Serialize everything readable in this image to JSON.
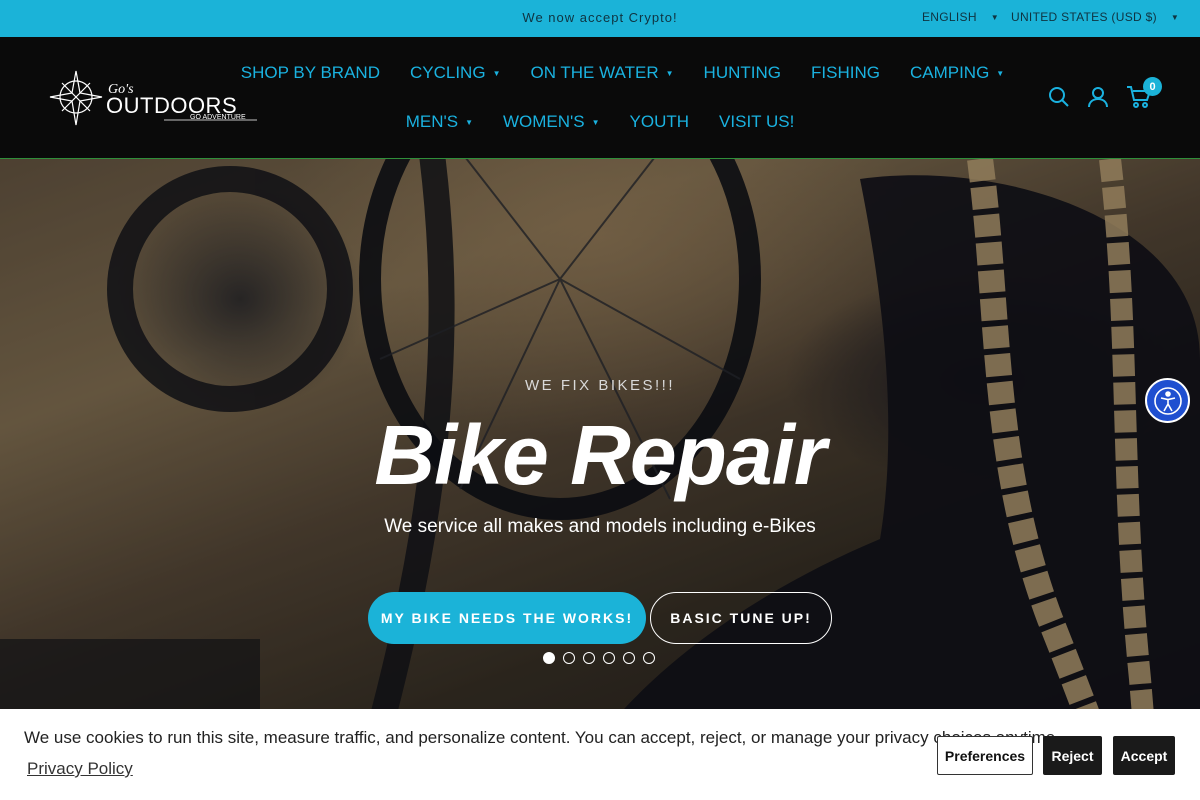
{
  "announcement": {
    "message": "We now accept Crypto!",
    "language": "ENGLISH",
    "currency": "UNITED STATES (USD $)"
  },
  "header": {
    "logo_alt": "Go's OUTDOORS GO ADVENTURE",
    "nav_row1": [
      {
        "label": "SHOP BY BRAND",
        "dropdown": false
      },
      {
        "label": "CYCLING",
        "dropdown": true
      },
      {
        "label": "ON THE WATER",
        "dropdown": true
      },
      {
        "label": "HUNTING",
        "dropdown": false
      },
      {
        "label": "FISHING",
        "dropdown": false
      },
      {
        "label": "CAMPING",
        "dropdown": true
      }
    ],
    "nav_row2": [
      {
        "label": "MEN'S",
        "dropdown": true
      },
      {
        "label": "WOMEN'S",
        "dropdown": true
      },
      {
        "label": "YOUTH",
        "dropdown": false
      },
      {
        "label": "VISIT US!",
        "dropdown": false
      }
    ],
    "cart_count": "0",
    "icons": [
      "search-icon",
      "account-icon",
      "cart-icon"
    ],
    "accent_color": "#1ab2e0"
  },
  "hero": {
    "eyebrow": "WE FIX BIKES!!!",
    "title": "Bike Repair",
    "subtitle": "We service all makes and models including e-Bikes",
    "primary_button": "MY BIKE NEEDS THE WORKS!",
    "secondary_button": "BASIC TUNE UP!",
    "slide_count": 6,
    "active_slide": 1
  },
  "cookie_banner": {
    "text": "We use cookies to run this site, measure traffic, and personalize content. You can accept, reject, or manage your privacy choices anytime.",
    "privacy_link": "Privacy Policy",
    "preferences": "Preferences",
    "reject": "Reject",
    "accept": "Accept"
  }
}
